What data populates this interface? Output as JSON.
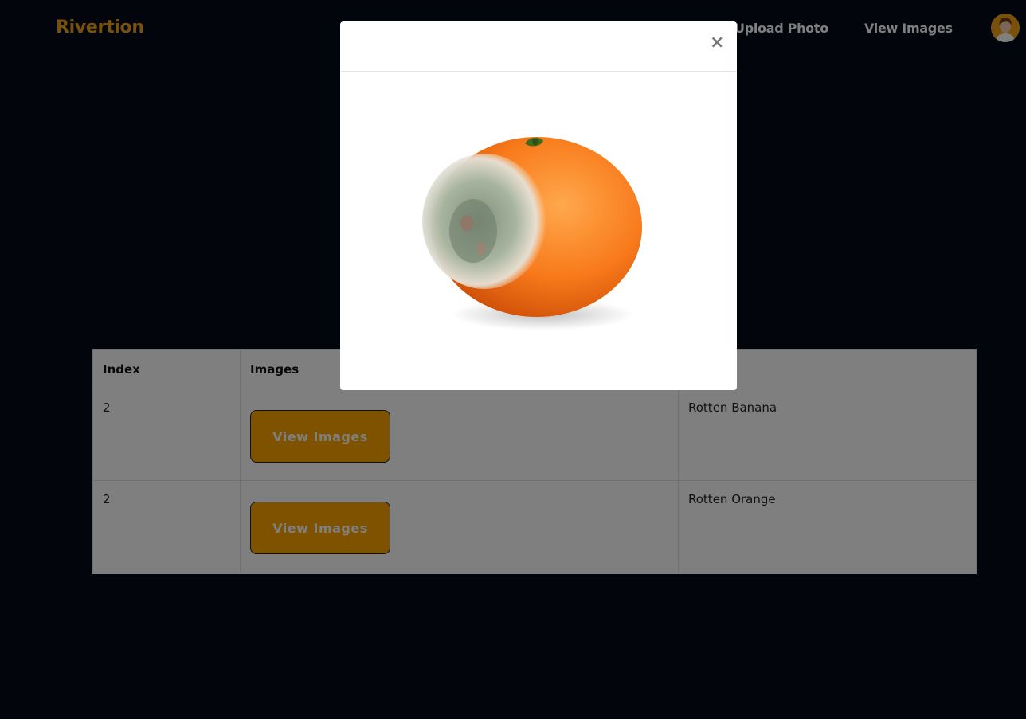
{
  "nav": {
    "brand": "Rivertion",
    "upload_label": "Upload Photo",
    "view_label": "View Images"
  },
  "table": {
    "headers": [
      "Index",
      "Images",
      ""
    ],
    "rows": [
      {
        "index": "2",
        "button": "View Images",
        "label": "Rotten Banana"
      },
      {
        "index": "2",
        "button": "View Images",
        "label": "Rotten Orange"
      }
    ]
  },
  "modal": {
    "close_symbol": "×",
    "image_subject": "rotten-orange"
  },
  "colors": {
    "accent": "#ffa500",
    "brand": "#f0a21a",
    "background": "#050b17"
  }
}
